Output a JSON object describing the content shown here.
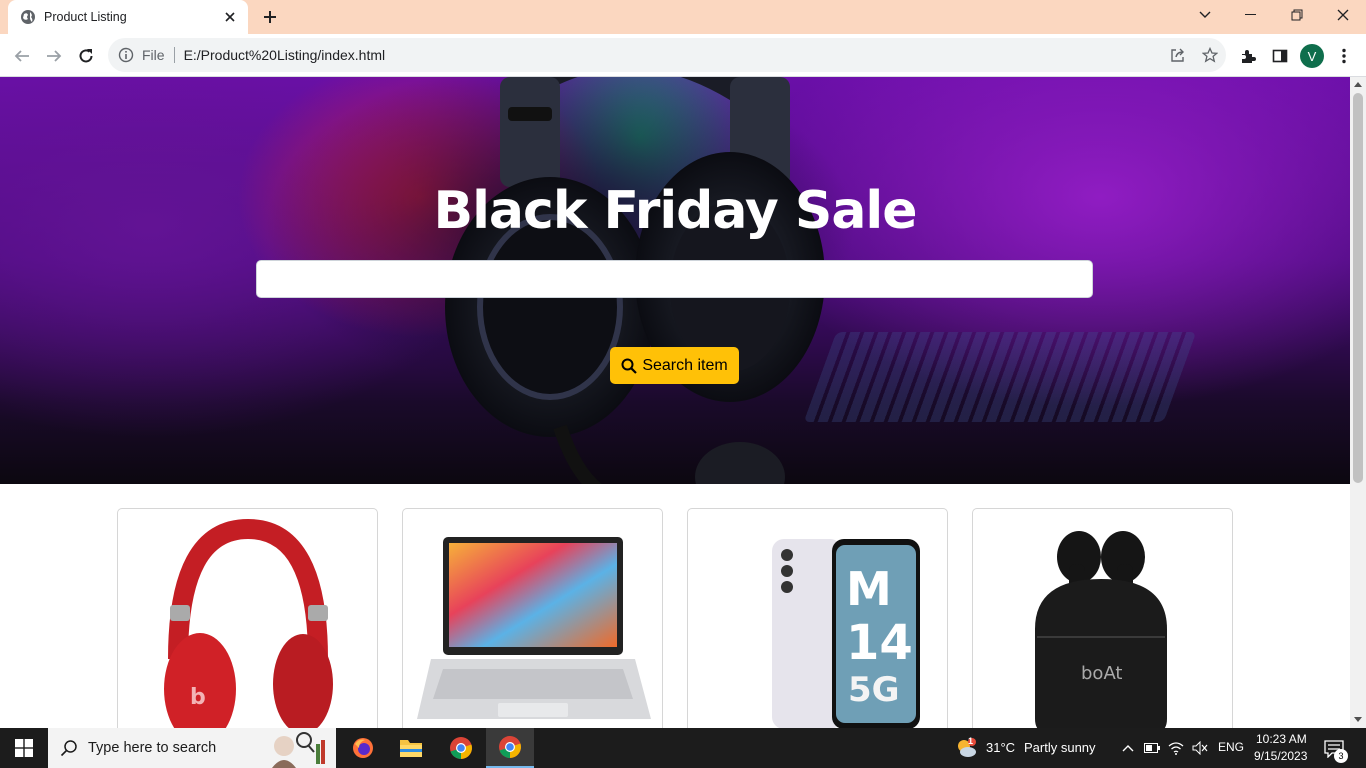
{
  "browser": {
    "tab_title": "Product Listing",
    "scheme_label": "File",
    "url": "E:/Product%20Listing/index.html",
    "profile_initial": "V",
    "accent_color": "#fbd7c0"
  },
  "hero": {
    "title": "Black Friday Sale",
    "search_value": "",
    "search_button_label": "Search item",
    "button_color": "#ffc107"
  },
  "products": [
    {
      "name": "red-headphones",
      "icon": "headphones-image"
    },
    {
      "name": "laptop",
      "icon": "laptop-image"
    },
    {
      "name": "smartphone",
      "icon": "phone-image"
    },
    {
      "name": "earbuds",
      "icon": "earbuds-image"
    }
  ],
  "phone_text": {
    "model": "M",
    "digits": "14",
    "network": "5G"
  },
  "earbuds_brand": "boAt",
  "taskbar": {
    "search_placeholder": "Type here to search",
    "weather_temp": "31°C",
    "weather_text": "Partly sunny",
    "language": "ENG",
    "time": "10:23 AM",
    "date": "9/15/2023",
    "notification_count": "3",
    "weather_badge": "1"
  }
}
